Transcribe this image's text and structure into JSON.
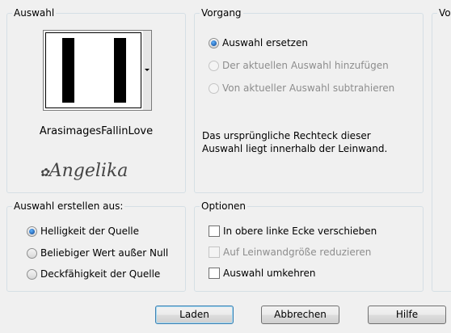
{
  "selection_group": {
    "title": "Auswahl",
    "image_name": "ArasimagesFallinLove",
    "watermark": "Angelika"
  },
  "operation_group": {
    "title": "Vorgang",
    "options": [
      {
        "label": "Auswahl ersetzen",
        "checked": true,
        "enabled": true
      },
      {
        "label": "Der aktuellen Auswahl hinzufügen",
        "checked": false,
        "enabled": false
      },
      {
        "label": "Von aktueller Auswahl subtrahieren",
        "checked": false,
        "enabled": false
      }
    ],
    "info_line1": "Das ursprüngliche Rechteck dieser",
    "info_line2": "Auswahl liegt innerhalb der Leinwand."
  },
  "third_group": {
    "title": "Vo"
  },
  "create_from_group": {
    "title": "Auswahl erstellen aus:",
    "options": [
      {
        "label": "Helligkeit der Quelle",
        "checked": true
      },
      {
        "label": "Beliebiger Wert außer Null",
        "checked": false
      },
      {
        "label": "Deckfähigkeit der Quelle",
        "checked": false
      }
    ]
  },
  "options_group": {
    "title": "Optionen",
    "options": [
      {
        "label": "In obere linke Ecke verschieben",
        "checked": false,
        "enabled": true
      },
      {
        "label": "Auf Leinwandgröße reduzieren",
        "checked": false,
        "enabled": false
      },
      {
        "label": "Auswahl umkehren",
        "checked": false,
        "enabled": true
      }
    ]
  },
  "buttons": {
    "load": "Laden",
    "cancel": "Abbrechen",
    "help": "Hilfe"
  }
}
